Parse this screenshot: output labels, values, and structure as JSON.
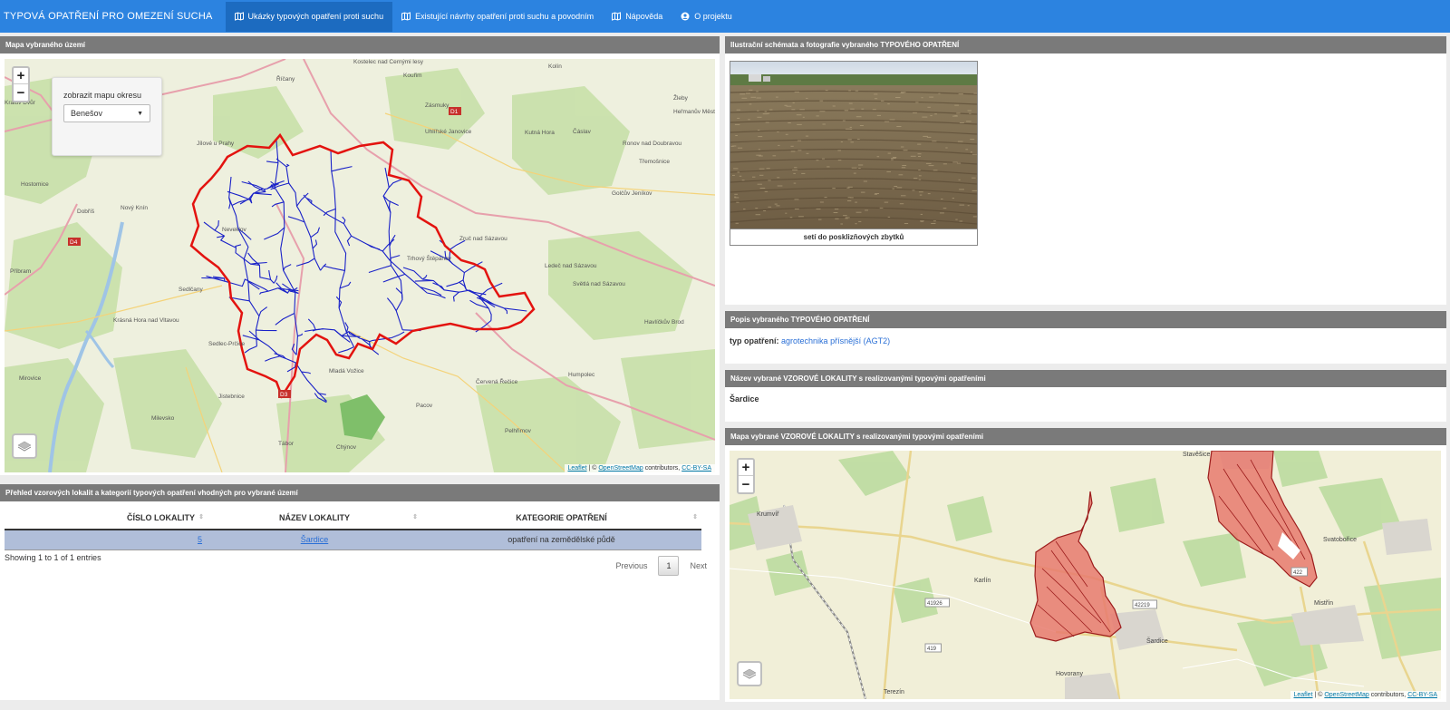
{
  "nav": {
    "brand": "TYPOVÁ OPATŘENÍ PRO OMEZENÍ SUCHA",
    "items": [
      {
        "label": "Ukázky typových opatření proti suchu",
        "icon": "map-icon",
        "active": true
      },
      {
        "label": "Existující návrhy opatření proti suchu a povodním",
        "icon": "map-icon",
        "active": false
      },
      {
        "label": "Nápověda",
        "icon": "map-icon",
        "active": false
      },
      {
        "label": "O projektu",
        "icon": "user-circle-icon",
        "active": false
      }
    ]
  },
  "map_panel": {
    "title": "Mapa vybraného území",
    "zoom_in": "+",
    "zoom_out": "−",
    "district_label": "zobrazit mapu okresu",
    "district_value": "Benešov",
    "attribution": {
      "leaflet": "Leaflet",
      "sep": " | © ",
      "osm": "OpenStreetMap",
      "contrib": " contributors, ",
      "license": "CC-BY-SA"
    },
    "place_labels": [
      "Říčany",
      "Kostelec nad Černými lesy",
      "Kouřim",
      "Kolín",
      "Kralův Dvůr",
      "Jílové u Prahy",
      "Mníšek pod Brdy",
      "Hostomice",
      "Dobříš",
      "Nový Knín",
      "Neveklov",
      "Příbram",
      "Sedlčany",
      "Krásná Hora nad Vltavou",
      "Sedlec-Prčice",
      "Mirovice",
      "Milevsko",
      "Jistebnice",
      "Mladá Vožice",
      "Pacov",
      "Tábor",
      "Chýnov",
      "Červená Řečice",
      "Pelhřimov",
      "Humpolec",
      "Havlíčkův Brod",
      "Světlá nad Sázavou",
      "Ledeč nad Sázavou",
      "Trhový Štěpánov",
      "Zruč nad Sázavou",
      "Golčův Jeníkov",
      "Kutná Hora",
      "Čáslav",
      "Uhlířské Janovice",
      "Zásmuky",
      "Ronov nad Doubravou",
      "Třemošnice",
      "Žleby",
      "Heřmanův Městec",
      "D1",
      "D3",
      "D4"
    ],
    "labels_visible": [
      "Říčany",
      "Kostelec nad Černými lesy",
      "Kouřim",
      "Kolín",
      "Kralův Dvůr",
      "Jílové u Prahy",
      "Mníšek pod Brdy",
      "Hostomice",
      "Dobříš",
      "Nový Knín",
      "Neveklov",
      "Příbram",
      "Sedlčany",
      "Krásná Hora nad Vltavou",
      "Sedlec-Prčice",
      "Mirovice",
      "Milevsko",
      "Jistebnice",
      "Mladá Vožice",
      "Pacov",
      "Tábor",
      "Chýnov",
      "Červená Řečice",
      "Pelhřimov",
      "Humpolec",
      "Havlíčkův Brod",
      "Světlá nad Sázavou",
      "Ledeč nad Sázavou",
      "Trhový Štěpánov",
      "Zruč nad Sázavou",
      "Golčův Jeníkov",
      "Kutná Hora",
      "Čáslav",
      "Uhlířské Janovice",
      "Zásmuky",
      "Ronov nad Doubravou",
      "Třemošnice",
      "Žleby",
      "Heřmanův Městec",
      "D1",
      "D3",
      "D4"
    ]
  },
  "table_panel": {
    "title": "Přehled vzorových lokalit a kategorií typových opatření vhodných pro vybrané území",
    "columns": [
      "ČÍSLO LOKALITY",
      "NÁZEV LOKALITY",
      "KATEGORIE OPATŘENÍ"
    ],
    "rows": [
      {
        "cislo": "5",
        "nazev": "Šardice",
        "kategorie": "opatření na zemědělské půdě"
      }
    ],
    "info": "Showing 1 to 1 of 1 entries",
    "prev": "Previous",
    "page": "1",
    "next": "Next"
  },
  "photo_panel": {
    "title": "Ilustrační schémata a fotografie vybraného TYPOVÉHO OPATŘENÍ",
    "caption": "setí do posklizňových zbytků"
  },
  "desc_panel": {
    "title": "Popis vybraného TYPOVÉHO OPATŘENÍ",
    "type_label": "typ opatření:",
    "type_value": "agrotechnika přísnější (AGT2)"
  },
  "name_panel": {
    "title": "Název vybrané VZOROVÉ LOKALITY s realizovanými typovými opatřeními",
    "value": "Šardice"
  },
  "locmap_panel": {
    "title": "Mapa vybrané VZOROVÉ LOKALITY s realizovanými typovými opatřeními",
    "zoom_in": "+",
    "zoom_out": "−",
    "labels": [
      "Krumvíř",
      "Stavěšice",
      "Svatobořice",
      "Karlín",
      "Mistřín",
      "Šardice",
      "Hovorany",
      "Terezín",
      "41926",
      "42219",
      "419",
      "422"
    ],
    "attribution": {
      "leaflet": "Leaflet",
      "sep": " | © ",
      "osm": "OpenStreetMap",
      "contrib": " contributors, ",
      "license": "CC-BY-SA"
    }
  },
  "colors": {
    "nav": "#2c83e0",
    "nav_active": "#1c6bc0",
    "panel_header": "#7a7a7a",
    "boundary": "#e3130f",
    "rivers": "#1a22c8",
    "row_highlight": "#b0bed9",
    "polygon_fill": "#e87a6e"
  }
}
